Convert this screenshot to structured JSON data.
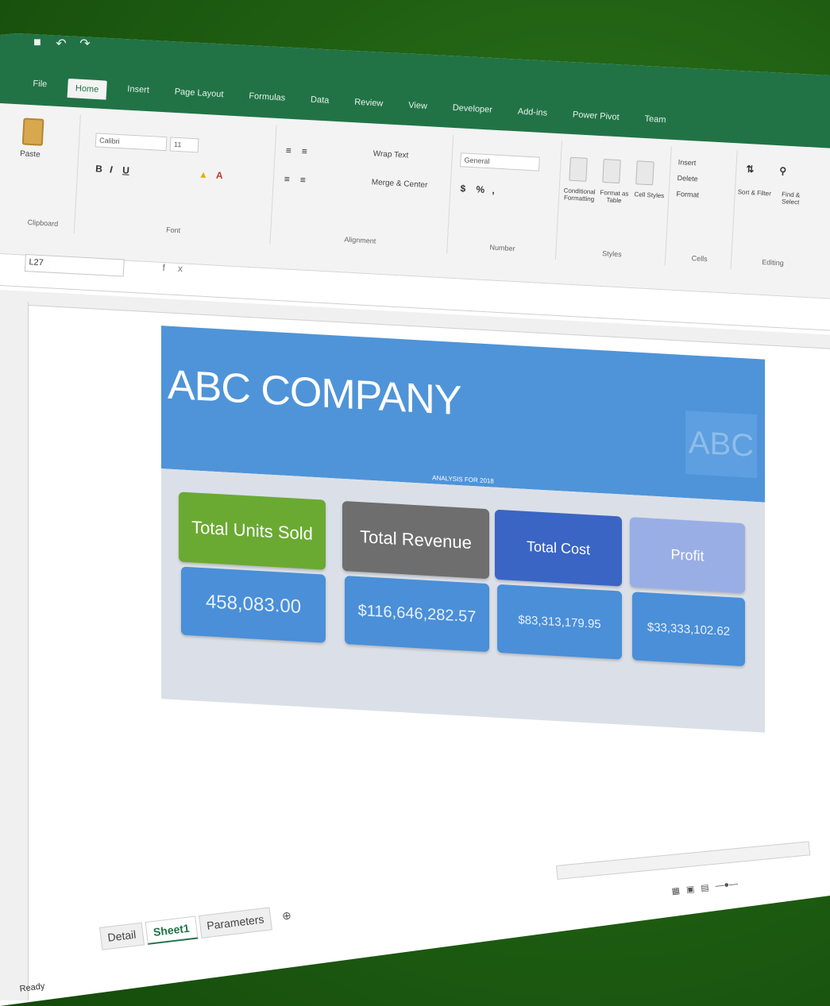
{
  "app": {
    "title": "",
    "quick_access": [
      "save-icon",
      "undo-icon",
      "redo-icon"
    ]
  },
  "ribbon": {
    "tabs": [
      "File",
      "Home",
      "Insert",
      "Page Layout",
      "Formulas",
      "Data",
      "Review",
      "View",
      "Developer",
      "Add-ins",
      "Power Pivot",
      "Team"
    ],
    "active_tab": "Home",
    "groups": {
      "clipboard": "Clipboard",
      "font": "Font",
      "alignment": "Alignment",
      "number": "Number",
      "styles": "Styles",
      "cells": "Cells",
      "editing": "Editing"
    },
    "font_name": "Calibri",
    "font_size": "11",
    "number_format": "General",
    "wrap_text": "Wrap Text",
    "merge_center": "Merge & Center",
    "paste": "Paste",
    "conditional_formatting": "Conditional Formatting",
    "format_as_table": "Format as Table",
    "cell_styles": "Cell Styles",
    "insert": "Insert",
    "delete": "Delete",
    "format": "Format",
    "sort_filter": "Sort & Filter",
    "find_select": "Find & Select"
  },
  "formula_bar": {
    "name_box": "L27",
    "fx": "fx"
  },
  "dashboard": {
    "company": "ABC COMPANY",
    "logo": "ABC",
    "subtitle": "ANALYSIS FOR 2018",
    "cards": [
      {
        "label": "Total Units Sold",
        "value": "458,083.00",
        "color": "#6aaa32"
      },
      {
        "label": "Total Revenue",
        "value": "$116,646,282.57",
        "color": "#6e6e6e"
      },
      {
        "label": "Total Cost",
        "value": "$83,313,179.95",
        "color": "#3a65c4"
      },
      {
        "label": "Profit",
        "value": "$33,333,102.62",
        "color": "#9aaee6"
      }
    ]
  },
  "sheet_tabs": [
    "Detail",
    "Sheet1",
    "Parameters"
  ],
  "active_sheet": "Sheet1",
  "status": "Ready",
  "colors": {
    "excel_green": "#217346",
    "banner_blue": "#4f94d8",
    "panel_gray": "#dbe0e8"
  }
}
